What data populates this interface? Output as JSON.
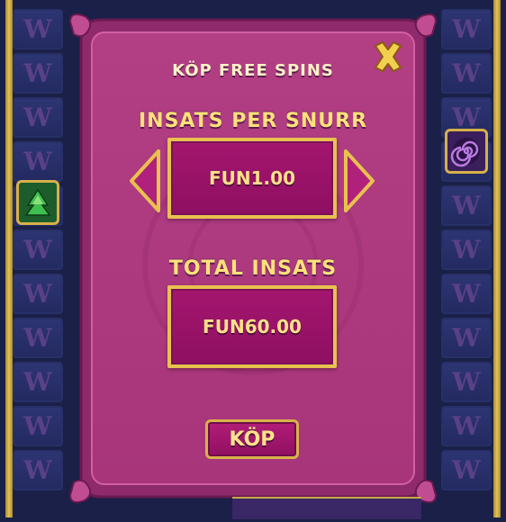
{
  "dialog": {
    "title": "KÖP FREE SPINS",
    "bet_label": "INSATS PER SNURR",
    "bet_value": "FUN1.00",
    "total_label": "TOTAL INSATS",
    "total_value": "FUN60.00",
    "buy_label": "KÖP"
  },
  "background": {
    "reel_symbol": "W",
    "left_icon": "tree-icon",
    "right_icon": "spiral-icon"
  },
  "colors": {
    "panel": "#b0397f",
    "panel_border": "#8d2468",
    "gold": "#e8c14f",
    "value_box": "#9c1468",
    "label_text": "#ffe27a",
    "background": "#1a2047"
  }
}
